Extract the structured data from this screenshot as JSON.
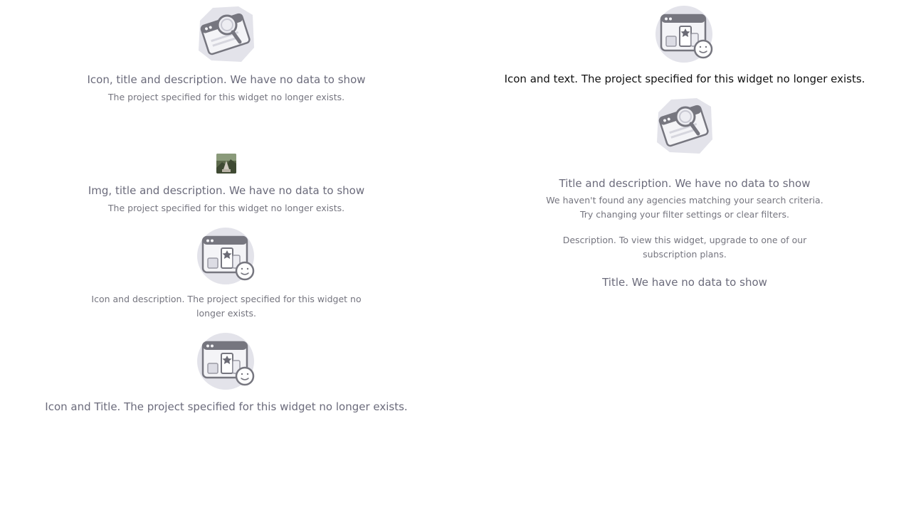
{
  "left_column": {
    "w1": {
      "icon": "search-document-illustration",
      "title": "Icon, title and description. We have no data to show",
      "description": "The project specified for this widget no longer exists."
    },
    "w2": {
      "image": "landscape-thumbnail",
      "title": "Img, title and description. We have no data to show",
      "description": "The project specified for this widget no longer exists."
    },
    "w3": {
      "icon": "favorites-window-illustration",
      "description": "Icon and description. The project specified for this widget no longer exists."
    },
    "w4": {
      "icon": "favorites-window-illustration",
      "title": "Icon and Title. The project specified for this widget no longer exists."
    }
  },
  "right_column": {
    "w5": {
      "icon": "favorites-window-illustration",
      "text": "Icon and text. The project specified for this widget no longer exists."
    },
    "w6": {
      "icon": "search-document-illustration",
      "title": "Title and description. We have no data to show",
      "description": "We haven't found any agencies matching your search criteria. Try changing your filter settings or clear filters."
    },
    "w7": {
      "description": "Description. To view this widget, upgrade to one of our subscription plans."
    },
    "w8": {
      "title": "Title. We have no data to show"
    }
  },
  "colors": {
    "illustration_bg": "#e3e3ea",
    "illustration_stroke": "#76767f",
    "text_title": "#6b6b7b",
    "text_plain": "#111111"
  }
}
